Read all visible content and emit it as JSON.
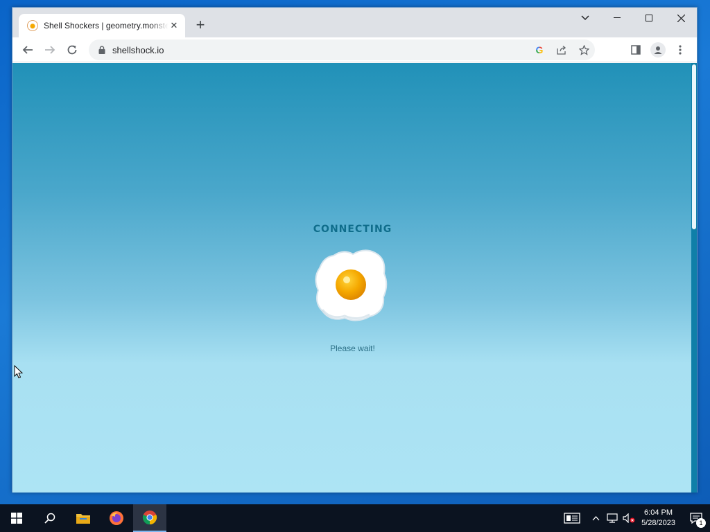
{
  "browser": {
    "tab_title": "Shell Shockers | geometry.monster",
    "new_tab_symbol": "+",
    "url": "shellshock.io"
  },
  "page": {
    "status_title": "CONNECTING",
    "status_message": "Please wait!"
  },
  "colors": {
    "page_top": "#2191b8",
    "page_bottom": "#ade4f4",
    "heading": "#0f6d8c",
    "egg_yolk": "#f5a800",
    "taskbar": "#0b1320"
  },
  "icons": {
    "tab": [
      "egg-favicon-icon",
      "close-icon"
    ],
    "toolbar": [
      "back-arrow-icon",
      "forward-arrow-icon",
      "reload-icon",
      "lock-icon",
      "google-icon",
      "share-icon",
      "star-icon",
      "side-panel-icon",
      "profile-icon",
      "kebab-menu-icon"
    ],
    "taskbar": [
      "windows-start-icon",
      "search-icon",
      "file-explorer-icon",
      "firefox-icon",
      "chrome-icon"
    ],
    "tray": [
      "news-icon",
      "chevron-up-icon",
      "network-icon",
      "volume-muted-icon",
      "notification-icon"
    ]
  },
  "taskbar": {
    "time": "6:04 PM",
    "date": "5/28/2023",
    "notification_count": "1"
  }
}
